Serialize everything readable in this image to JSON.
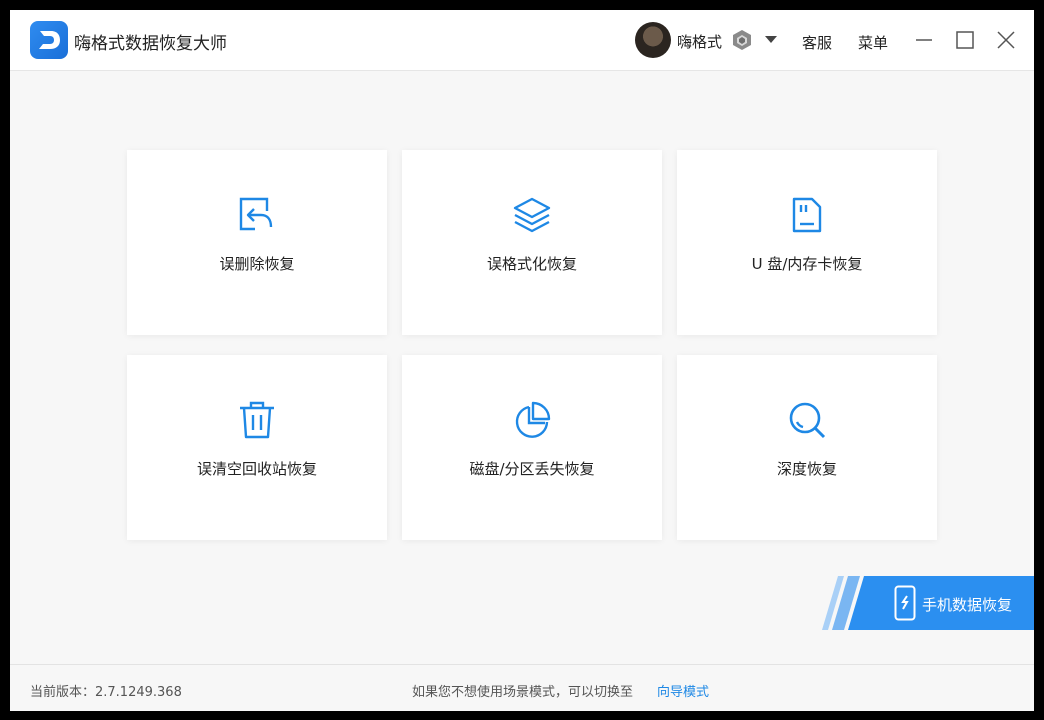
{
  "app": {
    "title": "嗨格式数据恢复大师"
  },
  "header": {
    "username": "嗨格式",
    "service_label": "客服",
    "menu_label": "菜单"
  },
  "cards": [
    {
      "label": "误删除恢复",
      "icon": "file-undo-icon"
    },
    {
      "label": "误格式化恢复",
      "icon": "layers-icon"
    },
    {
      "label": "U 盘/内存卡恢复",
      "icon": "sd-card-icon"
    },
    {
      "label": "误清空回收站恢复",
      "icon": "trash-icon"
    },
    {
      "label": "磁盘/分区丢失恢复",
      "icon": "pie-chart-icon"
    },
    {
      "label": "深度恢复",
      "icon": "search-icon"
    }
  ],
  "mobile": {
    "label": "手机数据恢复"
  },
  "footer": {
    "version": "当前版本：2.7.1249.368",
    "hint": "如果您不想使用场景模式，可以切换至",
    "guide_link": "向导模式"
  },
  "colors": {
    "accent": "#1e88e5",
    "banner": "#2b8ff0",
    "background": "#f7f7f7"
  }
}
